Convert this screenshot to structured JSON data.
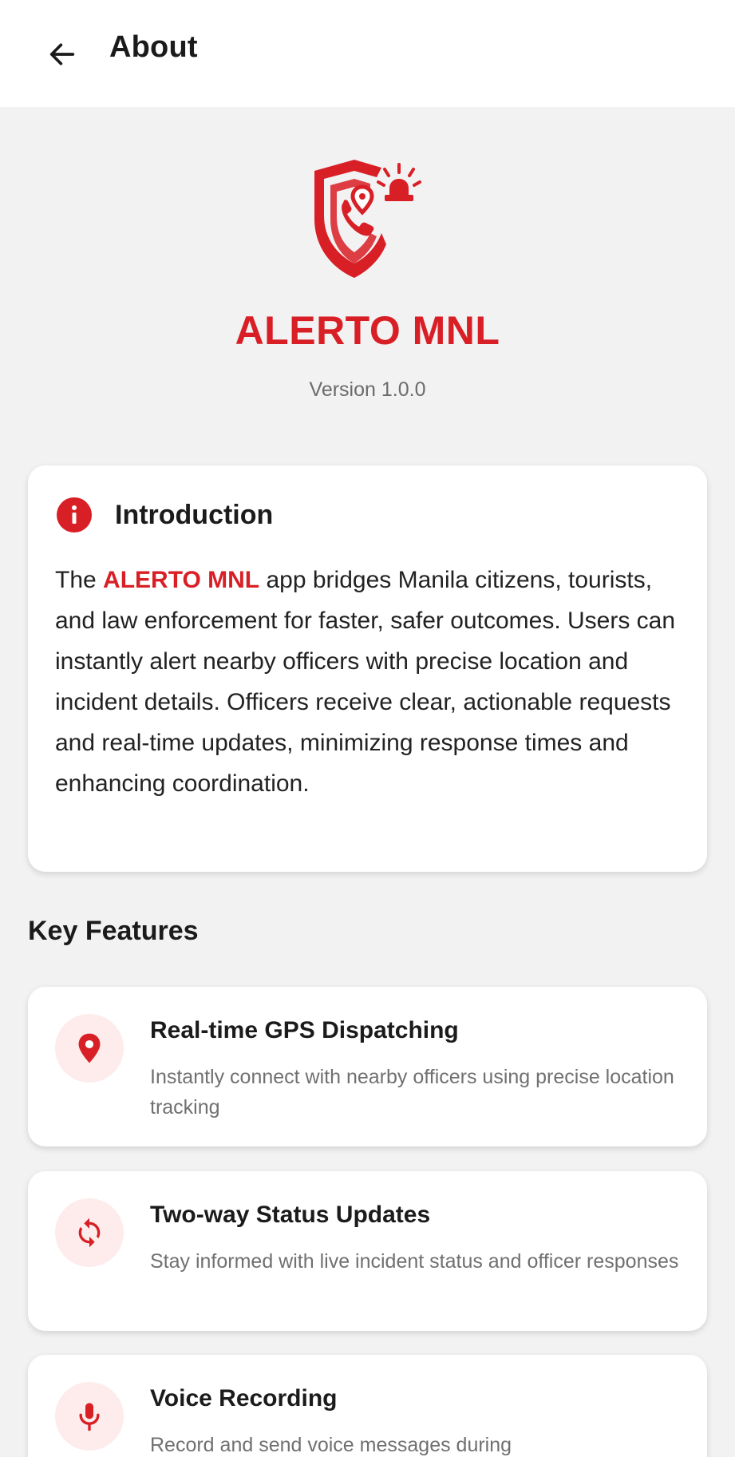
{
  "appbar": {
    "title": "About"
  },
  "header": {
    "app_name": "ALERTO MNL",
    "version": "Version 1.0.0",
    "logo_icon": "shield-phone-location-siren-logo",
    "brand_color": "#d91f26"
  },
  "intro": {
    "title": "Introduction",
    "icon": "info-icon",
    "text_before": "The ",
    "brand": "ALERTO MNL",
    "text_after": " app bridges Manila citizens, tourists, and law enforcement for faster, safer outcomes. Users can instantly alert nearby officers with precise location and incident details. Officers receive clear, actionable requests and real-time updates, minimizing response times and enhancing coordination."
  },
  "features": {
    "section_title": "Key Features",
    "items": [
      {
        "icon": "location-pin-icon",
        "title": "Real-time GPS Dispatching",
        "description": "Instantly connect with nearby officers using precise location tracking"
      },
      {
        "icon": "sync-icon",
        "title": "Two-way Status Updates",
        "description": "Stay informed with live incident status and officer responses"
      },
      {
        "icon": "microphone-icon",
        "title": "Voice Recording",
        "description": "Record and send voice messages during"
      }
    ]
  }
}
